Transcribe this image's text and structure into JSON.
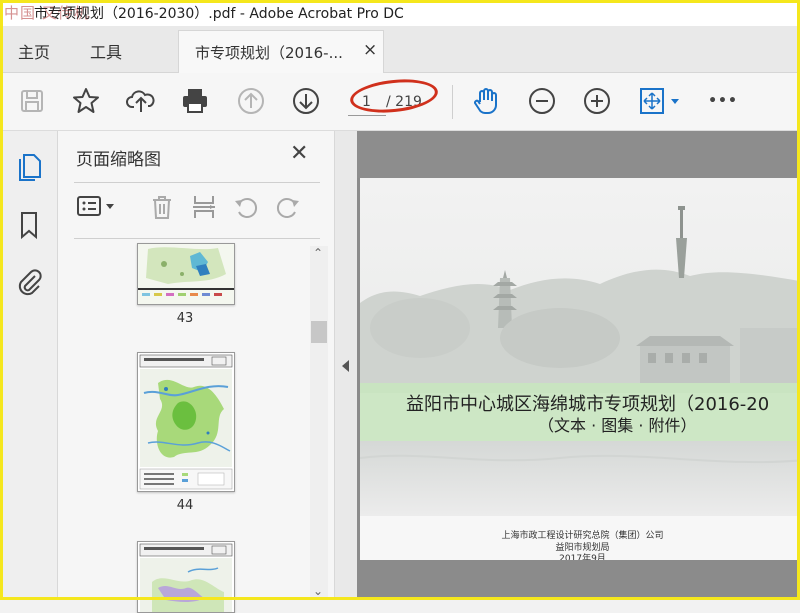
{
  "window": {
    "title": "市专项规划（2016-2030）.pdf - Adobe Acrobat Pro DC",
    "watermark": "中国 又传机"
  },
  "nav": {
    "home_label": "主页",
    "tools_label": "工具",
    "doc_tab_label": "市专项规划（2016-...",
    "close_glyph": "×"
  },
  "toolbar": {
    "icons": [
      "save-icon",
      "bookmark-star-icon",
      "upload-icon",
      "print-icon",
      "page-up-icon",
      "page-down-icon",
      "hand-tool-icon",
      "zoom-out-icon",
      "zoom-in-icon",
      "fit-page-icon",
      "more-icon"
    ],
    "current_page": "1",
    "total_pages": "/ 219",
    "more_glyph": "•••"
  },
  "panel": {
    "title": "页面缩略图",
    "close_glyph": "✕",
    "thumbnails": [
      {
        "label": "43"
      },
      {
        "label": "44"
      },
      {
        "label": ""
      }
    ]
  },
  "document": {
    "main_title": "益阳市中心城区海绵城市专项规划（2016-20",
    "subtitle": "（文本 · 图集 · 附件）",
    "org1": "上海市政工程设计研究总院（集团）公司",
    "org2": "益阳市规划局",
    "date": "2017年9月"
  },
  "colors": {
    "highlight_oval": "#d0301c",
    "accent_blue": "#1a73c9",
    "frame": "#f5e71d"
  }
}
